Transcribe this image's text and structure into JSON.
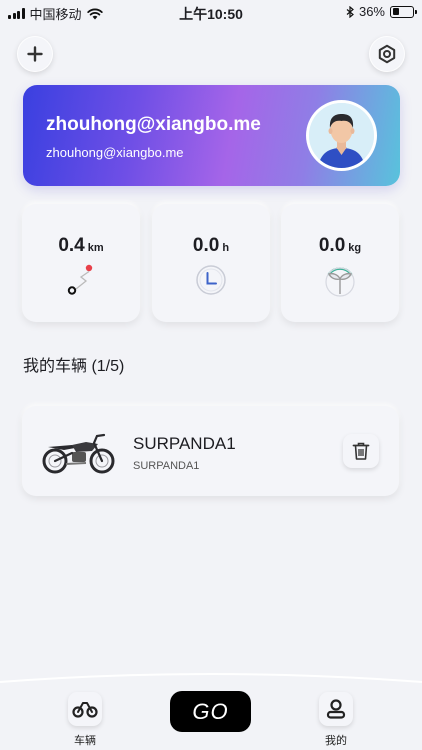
{
  "status_bar": {
    "carrier": "中国移动",
    "time": "上午10:50",
    "battery": "36%",
    "battery_level": 0.36
  },
  "header": {
    "add_icon": "plus-icon",
    "settings_icon": "hexagon-nut-icon"
  },
  "profile": {
    "name": "zhouhong@xiangbo.me",
    "email": "zhouhong@xiangbo.me"
  },
  "stats": [
    {
      "value": "0.4",
      "unit": "km",
      "icon": "route-icon"
    },
    {
      "value": "0.0",
      "unit": "h",
      "icon": "clock-icon"
    },
    {
      "value": "0.0",
      "unit": "kg",
      "icon": "leaf-gauge-icon"
    }
  ],
  "vehicles_section": {
    "title": "我的车辆 (1/5)"
  },
  "vehicles": [
    {
      "name": "SURPANDA1",
      "model": "SURPANDA1"
    }
  ],
  "bottom_nav": {
    "vehicles_label": "车辆",
    "go_label": "GO",
    "mine_label": "我的"
  },
  "colors": {
    "background": "#f2f3f7",
    "gradient_start": "#3a40e0",
    "gradient_mid": "#a565e8",
    "gradient_end": "#58c3dc",
    "accent_red": "#e8404a",
    "accent_blue": "#3d63c9",
    "accent_green": "#3fb39a"
  }
}
